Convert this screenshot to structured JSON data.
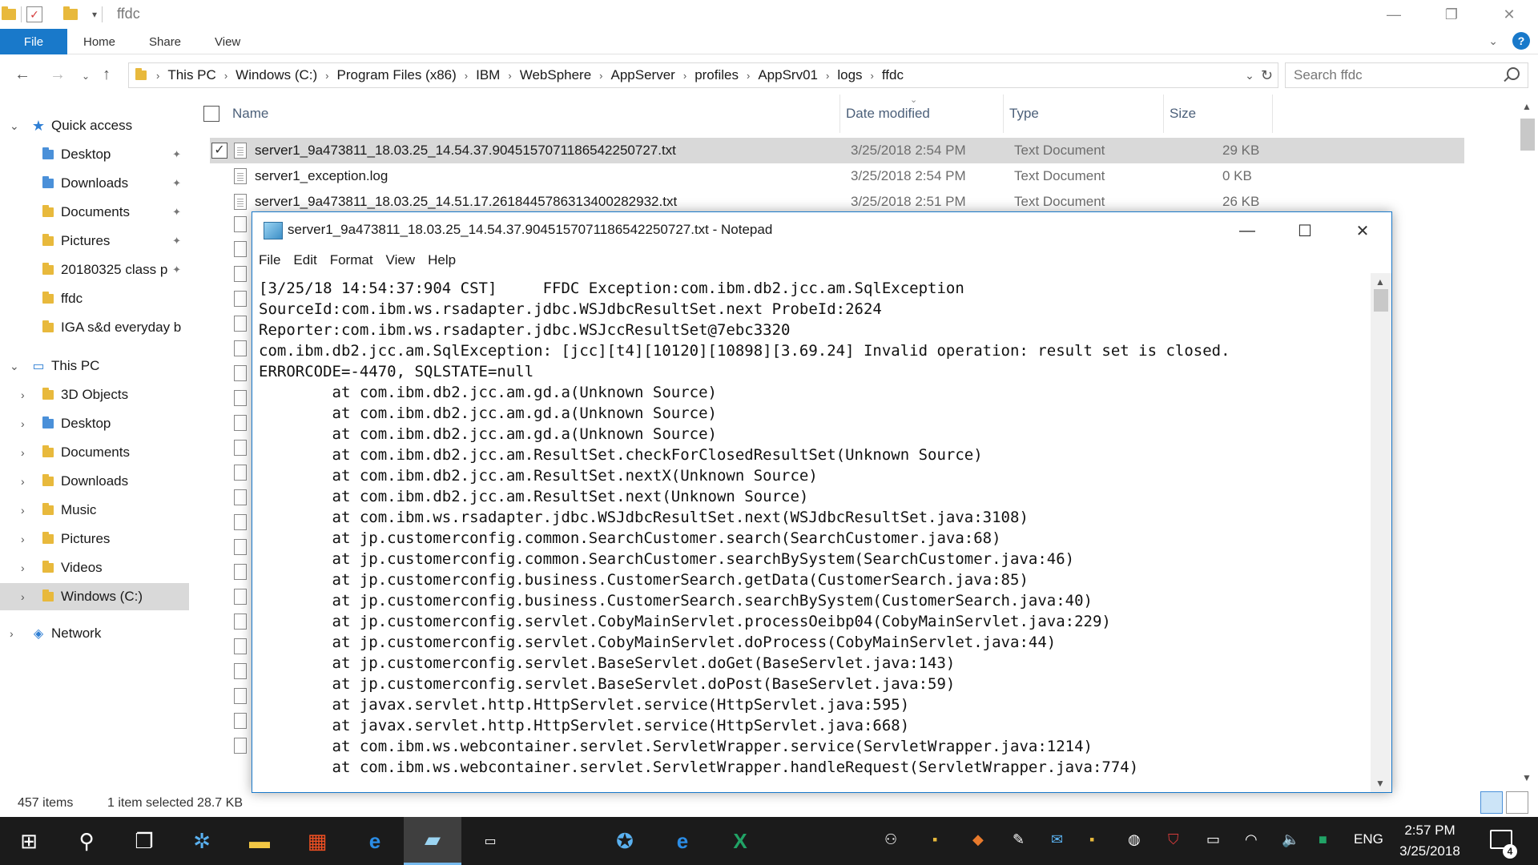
{
  "window_title": "ffdc",
  "window_controls": {
    "minimize": "—",
    "maximize": "❐",
    "close": "✕"
  },
  "ribbon": {
    "file": "File",
    "home": "Home",
    "share": "Share",
    "view": "View"
  },
  "address": {
    "crumbs": [
      "This PC",
      "Windows (C:)",
      "Program Files (x86)",
      "IBM",
      "WebSphere",
      "AppServer",
      "profiles",
      "AppSrv01",
      "logs",
      "ffdc"
    ]
  },
  "search": {
    "placeholder": "Search ffdc"
  },
  "nav": {
    "quick_access": "Quick access",
    "quick_items": [
      "Desktop",
      "Downloads",
      "Documents",
      "Pictures",
      "20180325 class p",
      "ffdc",
      "IGA s&d everyday b"
    ],
    "this_pc": "This PC",
    "pc_items": [
      "3D Objects",
      "Desktop",
      "Documents",
      "Downloads",
      "Music",
      "Pictures",
      "Videos",
      "Windows (C:)"
    ],
    "network": "Network"
  },
  "columns": {
    "name": "Name",
    "date": "Date modified",
    "type": "Type",
    "size": "Size"
  },
  "files": [
    {
      "name": "server1_9a473811_18.03.25_14.54.37.9045157071186542250727.txt",
      "date": "3/25/2018 2:54 PM",
      "type": "Text Document",
      "size": "29 KB"
    },
    {
      "name": "server1_exception.log",
      "date": "3/25/2018 2:54 PM",
      "type": "Text Document",
      "size": "0 KB"
    },
    {
      "name": "server1_9a473811_18.03.25_14.51.17.2618445786313400282932.txt",
      "date": "3/25/2018 2:51 PM",
      "type": "Text Document",
      "size": "26 KB"
    }
  ],
  "status": {
    "items": "457 items",
    "selected": "1 item selected  28.7 KB"
  },
  "notepad": {
    "title": "server1_9a473811_18.03.25_14.54.37.9045157071186542250727.txt - Notepad",
    "menu": [
      "File",
      "Edit",
      "Format",
      "View",
      "Help"
    ],
    "lines": [
      "[3/25/18 14:54:37:904 CST]     FFDC Exception:com.ibm.db2.jcc.am.SqlException",
      "SourceId:com.ibm.ws.rsadapter.jdbc.WSJdbcResultSet.next ProbeId:2624",
      "Reporter:com.ibm.ws.rsadapter.jdbc.WSJccResultSet@7ebc3320",
      "com.ibm.db2.jcc.am.SqlException: [jcc][t4][10120][10898][3.69.24] Invalid operation: result set is closed.",
      "ERRORCODE=-4470, SQLSTATE=null",
      "\tat com.ibm.db2.jcc.am.gd.a(Unknown Source)",
      "\tat com.ibm.db2.jcc.am.gd.a(Unknown Source)",
      "\tat com.ibm.db2.jcc.am.gd.a(Unknown Source)",
      "\tat com.ibm.db2.jcc.am.ResultSet.checkForClosedResultSet(Unknown Source)",
      "\tat com.ibm.db2.jcc.am.ResultSet.nextX(Unknown Source)",
      "\tat com.ibm.db2.jcc.am.ResultSet.next(Unknown Source)",
      "\tat com.ibm.ws.rsadapter.jdbc.WSJdbcResultSet.next(WSJdbcResultSet.java:3108)",
      "\tat jp.customerconfig.common.SearchCustomer.search(SearchCustomer.java:68)",
      "\tat jp.customerconfig.common.SearchCustomer.searchBySystem(SearchCustomer.java:46)",
      "\tat jp.customerconfig.business.CustomerSearch.getData(CustomerSearch.java:85)",
      "\tat jp.customerconfig.business.CustomerSearch.searchBySystem(CustomerSearch.java:40)",
      "\tat jp.customerconfig.servlet.CobyMainServlet.processOeibp04(CobyMainServlet.java:229)",
      "\tat jp.customerconfig.servlet.CobyMainServlet.doProcess(CobyMainServlet.java:44)",
      "\tat jp.customerconfig.servlet.BaseServlet.doGet(BaseServlet.java:143)",
      "\tat jp.customerconfig.servlet.BaseServlet.doPost(BaseServlet.java:59)",
      "\tat javax.servlet.http.HttpServlet.service(HttpServlet.java:595)",
      "\tat javax.servlet.http.HttpServlet.service(HttpServlet.java:668)",
      "\tat com.ibm.ws.webcontainer.servlet.ServletWrapper.service(ServletWrapper.java:1214)",
      "\tat com.ibm.ws.webcontainer.servlet.ServletWrapper.handleRequest(ServletWrapper.java:774)"
    ]
  },
  "taskbar": {
    "clock_time": "2:57 PM",
    "clock_date": "3/25/2018",
    "lang": "ENG",
    "notifications": "4"
  },
  "colors": {
    "accent": "#1979ca",
    "taskbar": "#1b1b1b",
    "selection": "#d9d9d9"
  }
}
